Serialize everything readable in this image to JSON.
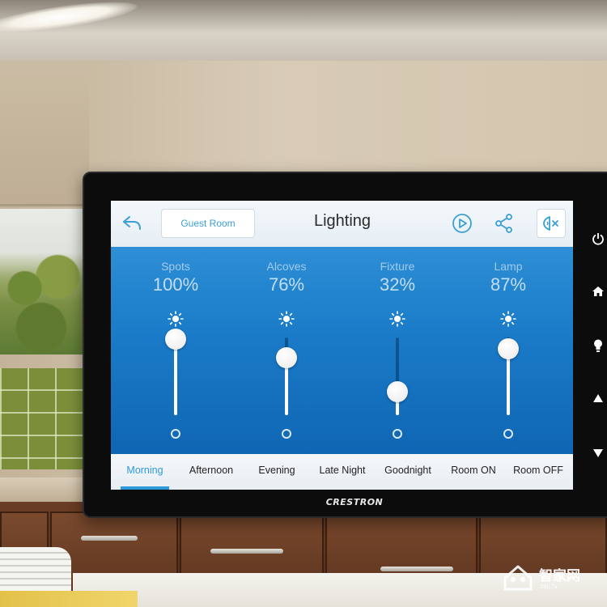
{
  "device": {
    "brand": "CRESTRON",
    "hardware_buttons": [
      {
        "name": "power",
        "glyph": "⏻"
      },
      {
        "name": "home",
        "glyph": "⌂"
      },
      {
        "name": "light",
        "glyph": "💡"
      },
      {
        "name": "up",
        "glyph": "▲"
      },
      {
        "name": "down",
        "glyph": "▼"
      }
    ]
  },
  "header": {
    "room_label": "Guest Room",
    "title": "Lighting"
  },
  "channels": [
    {
      "name": "Spots",
      "value_text": "100%",
      "level": 1.0
    },
    {
      "name": "Alcoves",
      "value_text": "76%",
      "level": 0.76
    },
    {
      "name": "Fixture",
      "value_text": "32%",
      "level": 0.32
    },
    {
      "name": "Lamp",
      "value_text": "87%",
      "level": 0.87
    }
  ],
  "scenes": [
    {
      "label": "Morning",
      "active": true
    },
    {
      "label": "Afternoon",
      "active": false
    },
    {
      "label": "Evening",
      "active": false
    },
    {
      "label": "Late Night",
      "active": false
    },
    {
      "label": "Goodnight",
      "active": false
    },
    {
      "label": "Room ON",
      "active": false
    },
    {
      "label": "Room OFF",
      "active": false
    }
  ],
  "watermark": {
    "text": "智家网",
    "sub": "ZNJJ.TV"
  },
  "colors": {
    "accent": "#2e9ad9",
    "panel_top": "#2e8fd6",
    "panel_bottom": "#0f66b3"
  }
}
